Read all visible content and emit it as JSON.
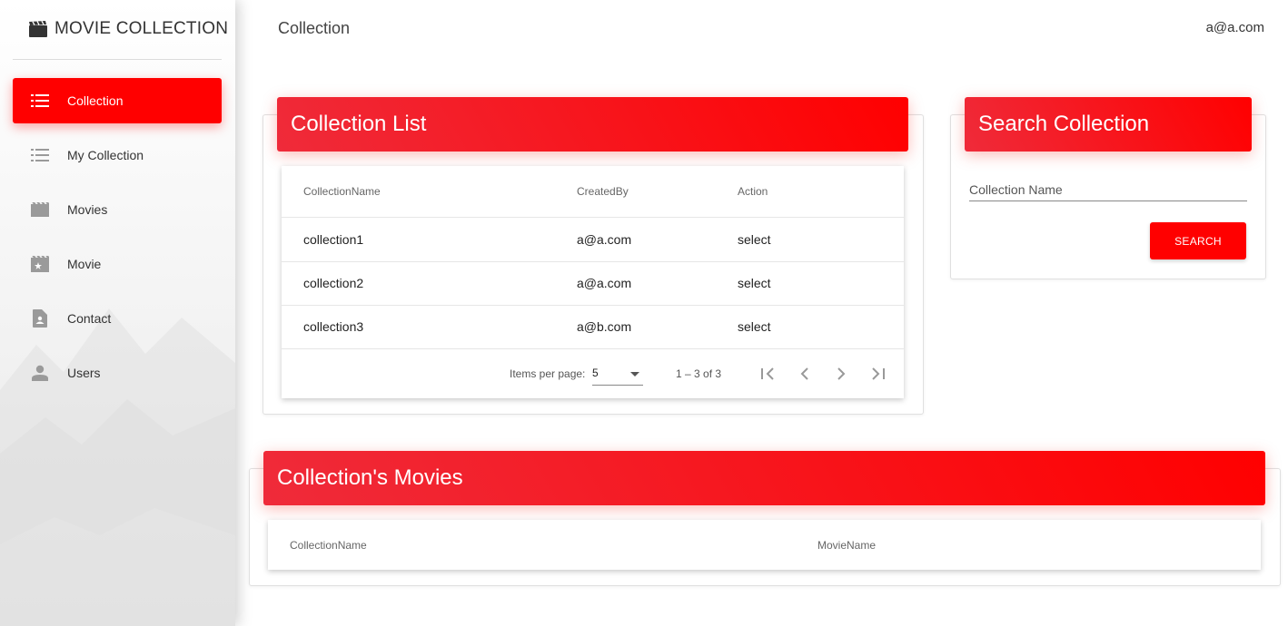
{
  "app": {
    "title": "MOVIE COLLECTION",
    "logo_icon": "clapperboard-icon"
  },
  "sidebar": {
    "items": [
      {
        "label": "Collection",
        "icon": "list-icon",
        "active": true
      },
      {
        "label": "My Collection",
        "icon": "list-icon",
        "active": false
      },
      {
        "label": "Movies",
        "icon": "movie-icon",
        "active": false
      },
      {
        "label": "Movie",
        "icon": "movie-filter-icon",
        "active": false
      },
      {
        "label": "Contact",
        "icon": "contact-document-icon",
        "active": false
      },
      {
        "label": "Users",
        "icon": "person-icon",
        "active": false
      }
    ]
  },
  "header": {
    "page_title": "Collection",
    "user_email": "a@a.com"
  },
  "collection_list": {
    "title": "Collection List",
    "columns": [
      "CollectionName",
      "CreatedBy",
      "Action"
    ],
    "rows": [
      {
        "name": "collection1",
        "created_by": "a@a.com",
        "action": "select"
      },
      {
        "name": "collection2",
        "created_by": "a@a.com",
        "action": "select"
      },
      {
        "name": "collection3",
        "created_by": "a@b.com",
        "action": "select"
      }
    ],
    "paginator": {
      "items_per_page_label": "Items per page:",
      "items_per_page": "5",
      "range": "1 – 3 of 3"
    }
  },
  "search": {
    "title": "Search Collection",
    "placeholder": "Collection Name",
    "button_label": "SEARCH"
  },
  "collection_movies": {
    "title": "Collection's Movies",
    "columns": [
      "CollectionName",
      "MovieName"
    ]
  },
  "colors": {
    "accent": "#ff0000",
    "header_gradient_start": "#ef2b3a",
    "header_gradient_end": "#ff0000"
  }
}
